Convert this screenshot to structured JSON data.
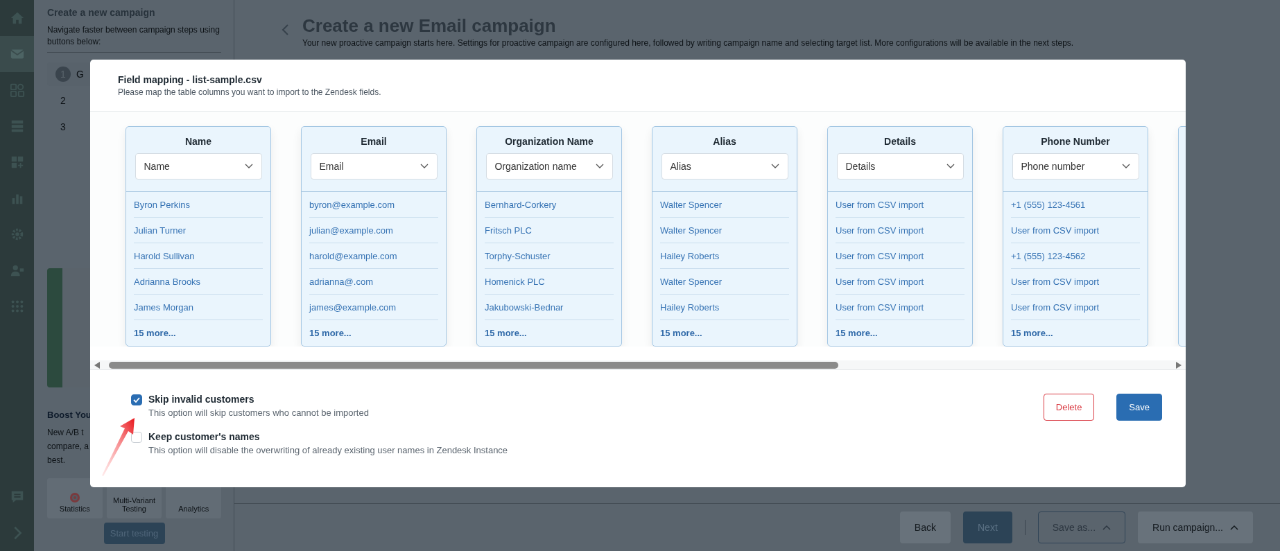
{
  "rail": {
    "items": [
      {
        "selected": false
      },
      {
        "selected": true
      },
      {
        "selected": false
      },
      {
        "selected": false
      },
      {
        "selected": false
      },
      {
        "selected": false
      },
      {
        "selected": false
      },
      {
        "selected": false
      },
      {
        "selected": false
      }
    ]
  },
  "sidebar": {
    "title": "Create a new campaign",
    "subtitle": "Navigate faster between campaign steps using buttons below:",
    "steps": [
      {
        "number": "1",
        "label": "G",
        "selected": true
      },
      {
        "number": "2",
        "selected": false
      },
      {
        "number": "3",
        "selected": false
      }
    ],
    "boost": {
      "title": "Boost You",
      "lines": [
        "New A/B t",
        "compare, a",
        "best."
      ]
    },
    "features": [
      "Statistics",
      "Multi-Variant Testing",
      "Analytics"
    ],
    "button": "Start testing"
  },
  "main": {
    "title": "Create a new Email campaign",
    "subtitle": "Your new proactive campaign starts here. Settings for proactive campaign are configured here, followed by writing campaign name and selecting target list. More configurations will be available in the next steps.",
    "footer": [
      {
        "label": "Back",
        "kind": "plain",
        "disabled": true,
        "caret": false
      },
      {
        "label": "Next",
        "kind": "primary",
        "disabled": false,
        "caret": false
      },
      {
        "label": "Save as...",
        "kind": "outline",
        "disabled": false,
        "caret": true
      },
      {
        "label": "Run campaign...",
        "kind": "plain",
        "disabled": true,
        "caret": true
      }
    ]
  },
  "modal": {
    "title": "Field mapping - list-sample.csv",
    "subtitle": "Please map the table columns you want to import to the Zendesk fields.",
    "columns": [
      {
        "kind": "full",
        "header": "Name",
        "mapping": "Name",
        "values": [
          "Byron Perkins",
          "Julian Turner",
          "Harold Sullivan",
          "Adrianna Brooks",
          "James Morgan"
        ],
        "more": "15 more..."
      },
      {
        "kind": "full",
        "header": "Email",
        "mapping": "Email",
        "values": [
          "byron@example.com",
          "julian@example.com",
          "harold@example.com",
          "adrianna@.com",
          "james@example.com"
        ],
        "more": "15 more..."
      },
      {
        "kind": "full",
        "header": "Organization Name",
        "mapping": "Organization name",
        "values": [
          "Bernhard-Corkery",
          "Fritsch PLC",
          "Torphy-Schuster",
          "Homenick PLC",
          "Jakubowski-Bednar"
        ],
        "more": "15 more..."
      },
      {
        "kind": "full",
        "header": "Alias",
        "mapping": "Alias",
        "values": [
          "Walter Spencer",
          "Walter Spencer",
          "Hailey Roberts",
          "Walter Spencer",
          "Hailey Roberts"
        ],
        "more": "15 more..."
      },
      {
        "kind": "full",
        "header": "Details",
        "mapping": "Details",
        "values": [
          "User from CSV import",
          "User from CSV import",
          "User from CSV import",
          "User from CSV import",
          "User from CSV import"
        ],
        "more": "15 more..."
      },
      {
        "kind": "full",
        "header": "Phone Number",
        "mapping": "Phone number",
        "values": [
          "+1 (555) 123-4561",
          "User from CSV import",
          "+1 (555) 123-4562",
          "User from CSV import",
          "User from CSV import"
        ],
        "more": "15 more..."
      },
      {
        "kind": "clipped"
      }
    ],
    "options": [
      {
        "label": "Skip invalid customers",
        "description": "This option will skip customers who cannot be imported",
        "checked": true
      },
      {
        "label": "Keep customer's names",
        "description": "This option will disable the overwriting of already existing user names in Zendesk Instance",
        "checked": false
      }
    ],
    "actions": [
      {
        "label": "Delete",
        "kind": "danger"
      },
      {
        "label": "Save",
        "kind": "primary"
      }
    ]
  }
}
